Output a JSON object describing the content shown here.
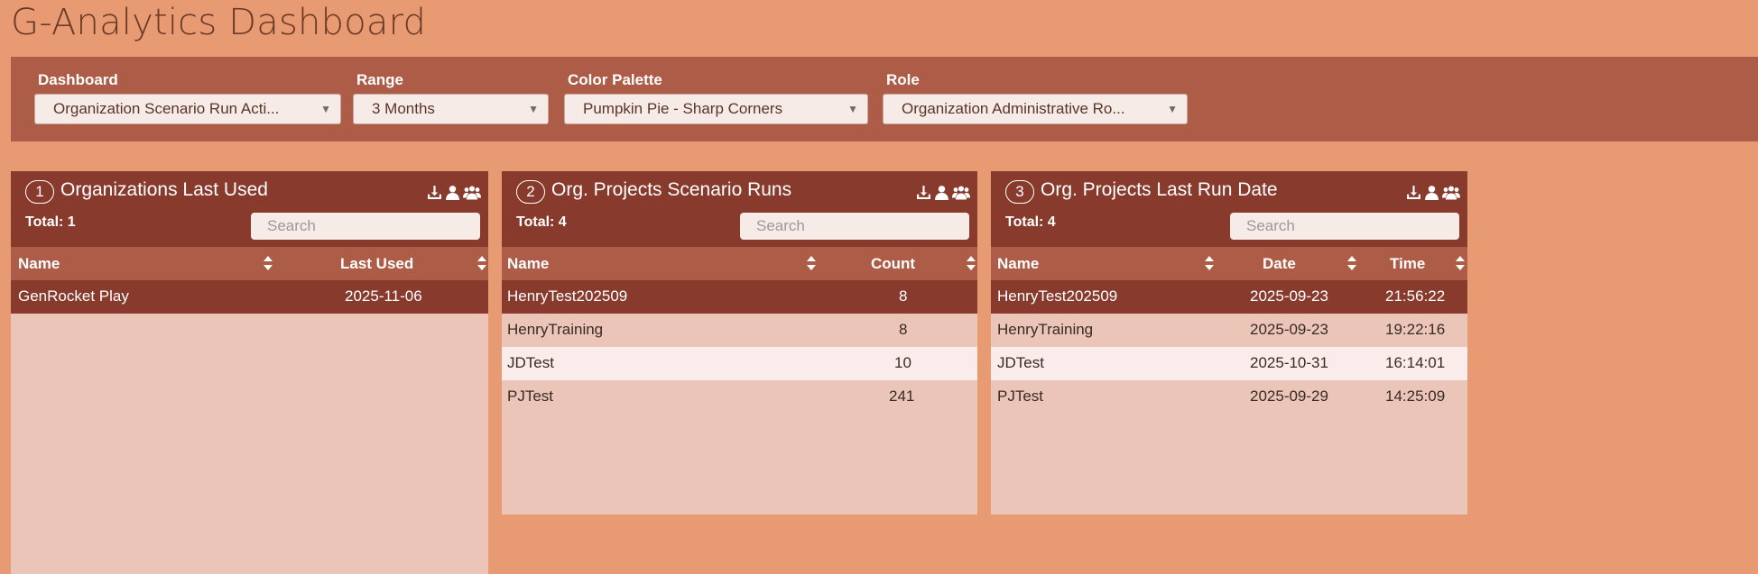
{
  "page": {
    "title": "G-Analytics Dashboard"
  },
  "filters": [
    {
      "label": "Dashboard",
      "value": "Organization Scenario Run Acti..."
    },
    {
      "label": "Range",
      "value": "3 Months"
    },
    {
      "label": "Color Palette",
      "value": "Pumpkin Pie - Sharp Corners"
    },
    {
      "label": "Role",
      "value": "Organization Administrative Ro..."
    }
  ],
  "panels": [
    {
      "number": "1",
      "title": "Organizations Last Used",
      "total": "Total: 1",
      "search_placeholder": "Search",
      "columns": [
        "Name",
        "Last Used"
      ],
      "rows": [
        [
          "GenRocket Play",
          "2025-11-06"
        ]
      ]
    },
    {
      "number": "2",
      "title": "Org. Projects Scenario Runs",
      "total": "Total: 4",
      "search_placeholder": "Search",
      "columns": [
        "Name",
        "Count"
      ],
      "rows": [
        [
          "HenryTest202509",
          "8"
        ],
        [
          "HenryTraining",
          "8"
        ],
        [
          "JDTest",
          "10"
        ],
        [
          "PJTest",
          "241"
        ]
      ]
    },
    {
      "number": "3",
      "title": "Org. Projects Last Run Date",
      "total": "Total: 4",
      "search_placeholder": "Search",
      "columns": [
        "Name",
        "Date",
        "Time"
      ],
      "rows": [
        [
          "HenryTest202509",
          "2025-09-23",
          "21:56:22"
        ],
        [
          "HenryTraining",
          "2025-09-23",
          "19:22:16"
        ],
        [
          "JDTest",
          "2025-10-31",
          "16:14:01"
        ],
        [
          "PJTest",
          "2025-09-29",
          "14:25:09"
        ]
      ]
    }
  ],
  "colors": {
    "background": "#e89b72",
    "filter_bar": "#ad5d47",
    "panel_header": "#883a2c",
    "table_header": "#ad5d47",
    "panel_body": "#ebc6b8",
    "row_highlight": "#f9ecea"
  },
  "icons": [
    "download-icon",
    "user-icon",
    "group-icon",
    "sort-icon",
    "caret-down-icon"
  ]
}
